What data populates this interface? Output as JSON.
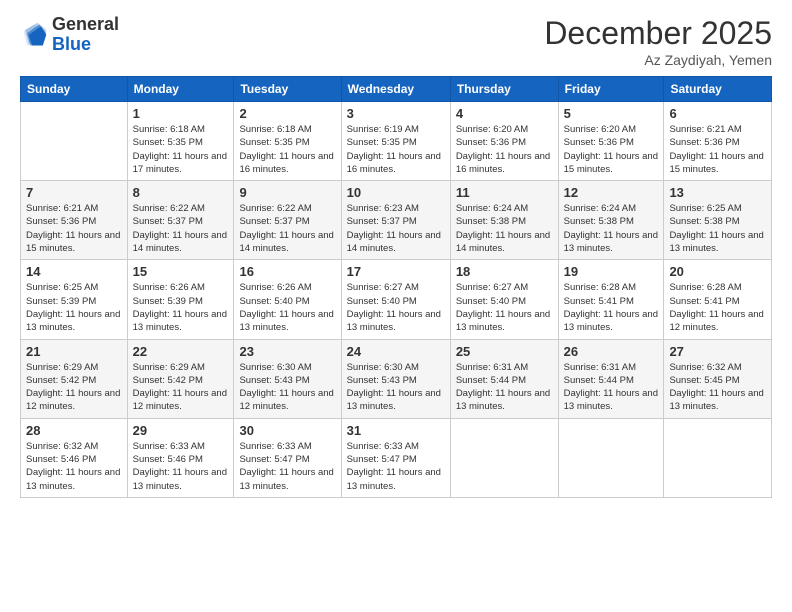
{
  "header": {
    "logo_line1": "General",
    "logo_line2": "Blue",
    "month": "December 2025",
    "location": "Az Zaydiyah, Yemen"
  },
  "weekdays": [
    "Sunday",
    "Monday",
    "Tuesday",
    "Wednesday",
    "Thursday",
    "Friday",
    "Saturday"
  ],
  "weeks": [
    [
      {
        "day": "",
        "sunrise": "",
        "sunset": "",
        "daylight": ""
      },
      {
        "day": "1",
        "sunrise": "Sunrise: 6:18 AM",
        "sunset": "Sunset: 5:35 PM",
        "daylight": "Daylight: 11 hours and 17 minutes."
      },
      {
        "day": "2",
        "sunrise": "Sunrise: 6:18 AM",
        "sunset": "Sunset: 5:35 PM",
        "daylight": "Daylight: 11 hours and 16 minutes."
      },
      {
        "day": "3",
        "sunrise": "Sunrise: 6:19 AM",
        "sunset": "Sunset: 5:35 PM",
        "daylight": "Daylight: 11 hours and 16 minutes."
      },
      {
        "day": "4",
        "sunrise": "Sunrise: 6:20 AM",
        "sunset": "Sunset: 5:36 PM",
        "daylight": "Daylight: 11 hours and 16 minutes."
      },
      {
        "day": "5",
        "sunrise": "Sunrise: 6:20 AM",
        "sunset": "Sunset: 5:36 PM",
        "daylight": "Daylight: 11 hours and 15 minutes."
      },
      {
        "day": "6",
        "sunrise": "Sunrise: 6:21 AM",
        "sunset": "Sunset: 5:36 PM",
        "daylight": "Daylight: 11 hours and 15 minutes."
      }
    ],
    [
      {
        "day": "7",
        "sunrise": "Sunrise: 6:21 AM",
        "sunset": "Sunset: 5:36 PM",
        "daylight": "Daylight: 11 hours and 15 minutes."
      },
      {
        "day": "8",
        "sunrise": "Sunrise: 6:22 AM",
        "sunset": "Sunset: 5:37 PM",
        "daylight": "Daylight: 11 hours and 14 minutes."
      },
      {
        "day": "9",
        "sunrise": "Sunrise: 6:22 AM",
        "sunset": "Sunset: 5:37 PM",
        "daylight": "Daylight: 11 hours and 14 minutes."
      },
      {
        "day": "10",
        "sunrise": "Sunrise: 6:23 AM",
        "sunset": "Sunset: 5:37 PM",
        "daylight": "Daylight: 11 hours and 14 minutes."
      },
      {
        "day": "11",
        "sunrise": "Sunrise: 6:24 AM",
        "sunset": "Sunset: 5:38 PM",
        "daylight": "Daylight: 11 hours and 14 minutes."
      },
      {
        "day": "12",
        "sunrise": "Sunrise: 6:24 AM",
        "sunset": "Sunset: 5:38 PM",
        "daylight": "Daylight: 11 hours and 13 minutes."
      },
      {
        "day": "13",
        "sunrise": "Sunrise: 6:25 AM",
        "sunset": "Sunset: 5:38 PM",
        "daylight": "Daylight: 11 hours and 13 minutes."
      }
    ],
    [
      {
        "day": "14",
        "sunrise": "Sunrise: 6:25 AM",
        "sunset": "Sunset: 5:39 PM",
        "daylight": "Daylight: 11 hours and 13 minutes."
      },
      {
        "day": "15",
        "sunrise": "Sunrise: 6:26 AM",
        "sunset": "Sunset: 5:39 PM",
        "daylight": "Daylight: 11 hours and 13 minutes."
      },
      {
        "day": "16",
        "sunrise": "Sunrise: 6:26 AM",
        "sunset": "Sunset: 5:40 PM",
        "daylight": "Daylight: 11 hours and 13 minutes."
      },
      {
        "day": "17",
        "sunrise": "Sunrise: 6:27 AM",
        "sunset": "Sunset: 5:40 PM",
        "daylight": "Daylight: 11 hours and 13 minutes."
      },
      {
        "day": "18",
        "sunrise": "Sunrise: 6:27 AM",
        "sunset": "Sunset: 5:40 PM",
        "daylight": "Daylight: 11 hours and 13 minutes."
      },
      {
        "day": "19",
        "sunrise": "Sunrise: 6:28 AM",
        "sunset": "Sunset: 5:41 PM",
        "daylight": "Daylight: 11 hours and 13 minutes."
      },
      {
        "day": "20",
        "sunrise": "Sunrise: 6:28 AM",
        "sunset": "Sunset: 5:41 PM",
        "daylight": "Daylight: 11 hours and 12 minutes."
      }
    ],
    [
      {
        "day": "21",
        "sunrise": "Sunrise: 6:29 AM",
        "sunset": "Sunset: 5:42 PM",
        "daylight": "Daylight: 11 hours and 12 minutes."
      },
      {
        "day": "22",
        "sunrise": "Sunrise: 6:29 AM",
        "sunset": "Sunset: 5:42 PM",
        "daylight": "Daylight: 11 hours and 12 minutes."
      },
      {
        "day": "23",
        "sunrise": "Sunrise: 6:30 AM",
        "sunset": "Sunset: 5:43 PM",
        "daylight": "Daylight: 11 hours and 12 minutes."
      },
      {
        "day": "24",
        "sunrise": "Sunrise: 6:30 AM",
        "sunset": "Sunset: 5:43 PM",
        "daylight": "Daylight: 11 hours and 13 minutes."
      },
      {
        "day": "25",
        "sunrise": "Sunrise: 6:31 AM",
        "sunset": "Sunset: 5:44 PM",
        "daylight": "Daylight: 11 hours and 13 minutes."
      },
      {
        "day": "26",
        "sunrise": "Sunrise: 6:31 AM",
        "sunset": "Sunset: 5:44 PM",
        "daylight": "Daylight: 11 hours and 13 minutes."
      },
      {
        "day": "27",
        "sunrise": "Sunrise: 6:32 AM",
        "sunset": "Sunset: 5:45 PM",
        "daylight": "Daylight: 11 hours and 13 minutes."
      }
    ],
    [
      {
        "day": "28",
        "sunrise": "Sunrise: 6:32 AM",
        "sunset": "Sunset: 5:46 PM",
        "daylight": "Daylight: 11 hours and 13 minutes."
      },
      {
        "day": "29",
        "sunrise": "Sunrise: 6:33 AM",
        "sunset": "Sunset: 5:46 PM",
        "daylight": "Daylight: 11 hours and 13 minutes."
      },
      {
        "day": "30",
        "sunrise": "Sunrise: 6:33 AM",
        "sunset": "Sunset: 5:47 PM",
        "daylight": "Daylight: 11 hours and 13 minutes."
      },
      {
        "day": "31",
        "sunrise": "Sunrise: 6:33 AM",
        "sunset": "Sunset: 5:47 PM",
        "daylight": "Daylight: 11 hours and 13 minutes."
      },
      {
        "day": "",
        "sunrise": "",
        "sunset": "",
        "daylight": ""
      },
      {
        "day": "",
        "sunrise": "",
        "sunset": "",
        "daylight": ""
      },
      {
        "day": "",
        "sunrise": "",
        "sunset": "",
        "daylight": ""
      }
    ]
  ]
}
